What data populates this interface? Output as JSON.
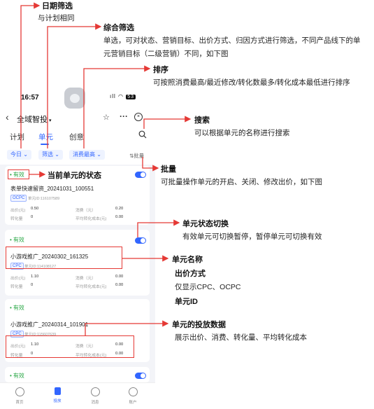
{
  "phone": {
    "status_time": "16:57",
    "battery": "53",
    "nav": {
      "title": "全域智投",
      "caret": "▾",
      "back": "‹",
      "star": "☆",
      "more": "···",
      "close": "×"
    },
    "tabs": [
      {
        "label": "计划"
      },
      {
        "label": "单元"
      },
      {
        "label": "创意"
      }
    ],
    "filters": {
      "date": "今日",
      "screen": "筛选",
      "sort": "消费最高",
      "batch": "批量"
    },
    "cards": [
      {
        "status": "有效",
        "name": "表单快速留资_20241031_100551",
        "bid_type": "OCPC",
        "unit_id": "单元ID:116107589",
        "bid_label": "出价(元)",
        "bid_value": "0.50",
        "spend_label": "消费（元）",
        "spend_value": "0.20",
        "conv_label": "转化量",
        "conv_value": "0",
        "cpa_label": "平均转化成本(元)",
        "cpa_value": "0.00"
      },
      {
        "status": "有效",
        "name": "小游戏推广_20240302_161325",
        "bid_type": "CPC",
        "unit_id": "单元ID:114108127",
        "bid_label": "出价(元)",
        "bid_value": "1.10",
        "spend_label": "消费（元）",
        "spend_value": "0.00",
        "conv_label": "转化量",
        "conv_value": "0",
        "cpa_label": "平均转化成本(元)",
        "cpa_value": "0.00"
      },
      {
        "status": "有效",
        "name": "小游戏推广_20240314_101901",
        "bid_type": "CPC",
        "unit_id": "单元ID:115607639",
        "bid_label": "出价(元)",
        "bid_value": "1.10",
        "spend_label": "消费（元）",
        "spend_value": "0.00",
        "conv_label": "转化量",
        "conv_value": "0",
        "cpa_label": "平均转化成本(元)",
        "cpa_value": "0.00"
      },
      {
        "status": "有效"
      }
    ],
    "bottom_nav": [
      {
        "label": "首页"
      },
      {
        "label": "投放"
      },
      {
        "label": "消息"
      },
      {
        "label": "账户"
      }
    ]
  },
  "annotations": {
    "date_filter": {
      "title": "日期筛选",
      "desc": "与计划相同"
    },
    "combo_filter": {
      "title": "综合筛选",
      "line1": "单选，可对状态、营销目标、出价方式、归因方式进行筛选，不同产品线下的单",
      "line2": "元营销目标（二级营销）不同，如下图"
    },
    "sort": {
      "title": "排序",
      "desc": "可按照消费最高/最近修改/转化数最多/转化成本最低进行排序"
    },
    "search": {
      "title": "搜索",
      "desc": "可以根据单元的名称进行搜索"
    },
    "batch": {
      "title": "批量",
      "desc": "可批量操作单元的开启、关闭、修改出价，如下图"
    },
    "current_status": {
      "title": "当前单元的状态"
    },
    "switch": {
      "title": "单元状态切换",
      "desc": "有效单元可切换暂停，暂停单元可切换有效"
    },
    "unit_name": {
      "title": "单元名称",
      "bid_title": "出价方式",
      "bid_desc": "仅显示CPC、OCPC",
      "id_title": "单元ID"
    },
    "unit_data": {
      "title": "单元的投放数据",
      "desc": "展示出价、消费、转化量、平均转化成本"
    }
  },
  "colors": {
    "annotation_red": "#e53935",
    "accent_blue": "#3266ff",
    "status_green": "#29a745"
  }
}
